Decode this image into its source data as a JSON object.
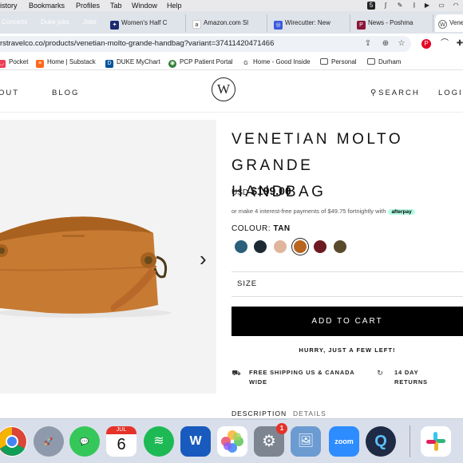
{
  "menubar": {
    "items": [
      "istory",
      "Bookmarks",
      "Profiles",
      "Tab",
      "Window",
      "Help"
    ],
    "right_icons": [
      "5-badge-icon",
      "stylus-icon",
      "pencil-icon",
      "bluetooth-icon",
      "play-icon",
      "battery-icon",
      "wifi-icon",
      "search-icon",
      "control-center-icon",
      "user-icon"
    ]
  },
  "tabstrip": {
    "groups": [
      {
        "label": "Concerts",
        "color": "#d93025"
      },
      {
        "label": "Duke jobs",
        "color": "#5f6368"
      },
      {
        "label": "Jobs",
        "color": "#1a73e8"
      }
    ],
    "tabs": [
      {
        "label": "Women's Half C",
        "icon": "bird-icon",
        "color": "#1d2b6e"
      },
      {
        "label": "Amazon.com Sl",
        "icon": "amazon-icon",
        "color": "#222222"
      },
      {
        "label": "Wirecutter: New",
        "icon": "wirecutter-icon",
        "color": "#3b5bdb"
      },
      {
        "label": "News - Poshma",
        "icon": "poshmark-icon",
        "color": "#8a1538"
      },
      {
        "label": "Vene",
        "icon": "w-logo-icon",
        "color": "#444444",
        "active": true
      }
    ]
  },
  "address_bar": {
    "url": "rstravelco.co/products/venetian-molto-grande-handbag?variant=37411420471466",
    "icons": [
      "share-icon",
      "extension-icon",
      "bookmark-star-icon",
      "pinterest-icon",
      "arc-icon",
      "puzzle-icon"
    ]
  },
  "bookmarks": [
    {
      "label": "Pocket",
      "icon": "pocket-icon",
      "color": "#ef3f56"
    },
    {
      "label": "Home | Substack",
      "icon": "substack-icon",
      "color": "#ff6719"
    },
    {
      "label": "DUKE MyChart",
      "icon": "duke-icon",
      "color": "#00539b"
    },
    {
      "label": "PCP Patient Portal",
      "icon": "portal-icon",
      "color": "#2e7d32"
    },
    {
      "label": "Home - Good Inside",
      "icon": "good-inside-icon",
      "color": "#333333"
    },
    {
      "label": "Personal",
      "icon": "folder-icon",
      "color": "#555555"
    },
    {
      "label": "Durham",
      "icon": "folder-icon",
      "color": "#555555"
    }
  ],
  "site": {
    "nav_left": [
      "OUT",
      "BLOG"
    ],
    "logo": "W",
    "nav_right": [
      "SEARCH",
      "LOGIN"
    ]
  },
  "product": {
    "title": "VENETIAN MOLTO GRANDE\nHANDBAG",
    "currency": "USD",
    "price": "$199.00",
    "afterpay_text": "or make 4 interest-free payments of $49.75 fortnightly with",
    "afterpay_badge": "afterpay",
    "colour_label": "COLOUR:",
    "colour_value": "TAN",
    "swatches": [
      {
        "name": "teal",
        "color": "#2b5f7a"
      },
      {
        "name": "navy",
        "color": "#1d2a36"
      },
      {
        "name": "blush",
        "color": "#e0b59c"
      },
      {
        "name": "tan",
        "color": "#b8651f",
        "selected": true
      },
      {
        "name": "burgundy",
        "color": "#6e1a22"
      },
      {
        "name": "olive",
        "color": "#5a4a2c"
      }
    ],
    "size_label": "SIZE",
    "add_to_cart": "ADD TO CART",
    "hurry": "HURRY, JUST A FEW LEFT!",
    "shipping": "FREE SHIPPING US & CANADA WIDE",
    "returns": "14 DAY RETURNS",
    "tabs": [
      "DESCRIPTION",
      "DETAILS"
    ]
  },
  "dock": {
    "apps": [
      {
        "name": "chrome",
        "color": "#ffffff"
      },
      {
        "name": "launchpad",
        "color": "#8e99ab"
      },
      {
        "name": "messages",
        "color": "#35c759"
      },
      {
        "name": "calendar",
        "color": "#ffffff",
        "month": "JUL",
        "day": "6"
      },
      {
        "name": "spotify",
        "color": "#1db954"
      },
      {
        "name": "word",
        "color": "#185abd",
        "text": "W"
      },
      {
        "name": "photos",
        "color": "#ffffff"
      },
      {
        "name": "system-preferences",
        "color": "#7d8591",
        "badge": "1"
      },
      {
        "name": "preview",
        "color": "#6c9bd2"
      },
      {
        "name": "zoom",
        "color": "#2d8cff",
        "text": "zoom"
      },
      {
        "name": "quicktime",
        "color": "#1f2a44",
        "text": "Q"
      },
      {
        "name": "slack",
        "color": "#ffffff"
      }
    ]
  }
}
